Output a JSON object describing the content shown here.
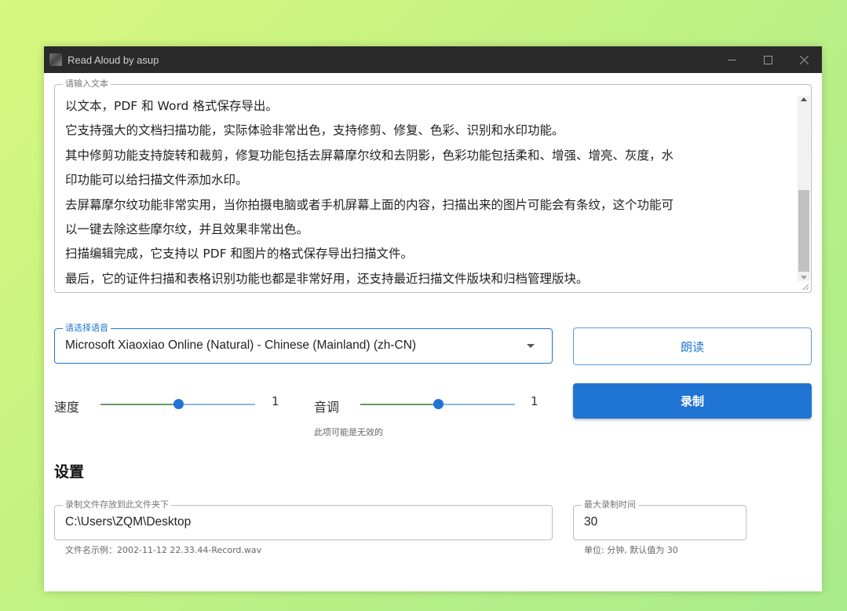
{
  "window": {
    "title": "Read Aloud by asup",
    "controls": {
      "minimize": "—",
      "maximize": "☐",
      "close": "✕"
    }
  },
  "text_input": {
    "legend": "请输入文本",
    "lines": [
      "以文本，PDF 和 Word 格式保存导出。",
      "它支持强大的文档扫描功能，实际体验非常出色，支持修剪、修复、色彩、识别和水印功能。",
      "其中修剪功能支持旋转和裁剪，修复功能包括去屏幕摩尔纹和去阴影，色彩功能包括柔和、增强、增亮、灰度，水",
      "印功能可以给扫描文件添加水印。",
      "去屏幕摩尔纹功能非常实用，当你拍摄电脑或者手机屏幕上面的内容，扫描出来的图片可能会有条纹，这个功能可",
      "以一键去除这些摩尔纹，并且效果非常出色。",
      "扫描编辑完成，它支持以 PDF 和图片的格式保存导出扫描文件。",
      "最后，它的证件扫描和表格识别功能也都是非常好用，还支持最近扫描文件版块和归档管理版块。"
    ]
  },
  "voice": {
    "legend": "请选择语音",
    "selected": "Microsoft Xiaoxiao Online (Natural) - Chinese (Mainland) (zh-CN)"
  },
  "buttons": {
    "read": "朗读",
    "record": "录制"
  },
  "speed": {
    "label": "速度",
    "value": "1",
    "level": 0.5
  },
  "pitch": {
    "label": "音调",
    "value": "1",
    "level": 0.5,
    "hint": "此项可能是无效的"
  },
  "settings": {
    "title": "设置",
    "folder": {
      "legend": "录制文件存放到此文件夹下",
      "value": "C:\\Users\\ZQM\\Desktop",
      "hint": "文件名示例：2002-11-12 22.33.44-Record.wav"
    },
    "max_time": {
      "legend": "最大录制时间",
      "value": "30",
      "hint": "单位: 分钟, 默认值为 30"
    }
  },
  "colors": {
    "accent": "#1f74d4",
    "titlebar": "#2a2a2a"
  }
}
